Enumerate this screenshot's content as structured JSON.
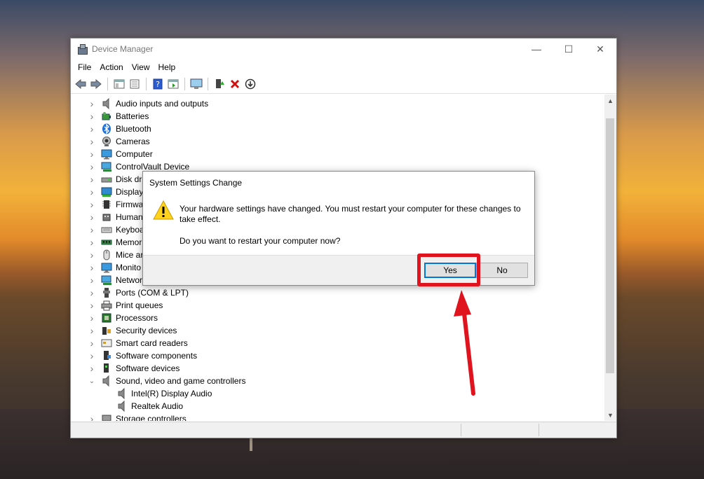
{
  "window": {
    "title": "Device Manager",
    "controls": {
      "minimize": "—",
      "maximize": "☐",
      "close": "✕"
    }
  },
  "menu": [
    "File",
    "Action",
    "View",
    "Help"
  ],
  "toolbar_icons": [
    "back-icon",
    "forward-icon",
    "console-tree-icon",
    "properties-icon",
    "help-icon",
    "action-pane-icon",
    "scan-hardware-icon",
    "update-driver-icon",
    "uninstall-icon",
    "disable-device-icon"
  ],
  "tree": [
    {
      "label": "Audio inputs and outputs",
      "icon": "speaker-icon",
      "expanded": false,
      "level": 0
    },
    {
      "label": "Batteries",
      "icon": "battery-icon",
      "expanded": false,
      "level": 0
    },
    {
      "label": "Bluetooth",
      "icon": "bluetooth-icon",
      "expanded": false,
      "level": 0
    },
    {
      "label": "Cameras",
      "icon": "camera-icon",
      "expanded": false,
      "level": 0
    },
    {
      "label": "Computer",
      "icon": "monitor-icon",
      "expanded": false,
      "level": 0
    },
    {
      "label": "ControlVault Device",
      "icon": "network-monitor-icon",
      "expanded": false,
      "level": 0
    },
    {
      "label": "Disk dri",
      "icon": "disk-icon",
      "expanded": false,
      "level": 0
    },
    {
      "label": "Display",
      "icon": "display-adapter-icon",
      "expanded": false,
      "level": 0
    },
    {
      "label": "Firmwa",
      "icon": "chip-icon",
      "expanded": false,
      "level": 0
    },
    {
      "label": "Human",
      "icon": "hid-icon",
      "expanded": false,
      "level": 0
    },
    {
      "label": "Keyboa",
      "icon": "keyboard-icon",
      "expanded": false,
      "level": 0
    },
    {
      "label": "Memor",
      "icon": "memory-icon",
      "expanded": false,
      "level": 0
    },
    {
      "label": "Mice ar",
      "icon": "mouse-icon",
      "expanded": false,
      "level": 0
    },
    {
      "label": "Monito",
      "icon": "monitor-icon",
      "expanded": false,
      "level": 0
    },
    {
      "label": "Networ",
      "icon": "network-monitor-icon",
      "expanded": false,
      "level": 0
    },
    {
      "label": "Ports (COM & LPT)",
      "icon": "port-icon",
      "expanded": false,
      "level": 0
    },
    {
      "label": "Print queues",
      "icon": "printer-icon",
      "expanded": false,
      "level": 0
    },
    {
      "label": "Processors",
      "icon": "processor-icon",
      "expanded": false,
      "level": 0
    },
    {
      "label": "Security devices",
      "icon": "security-device-icon",
      "expanded": false,
      "level": 0
    },
    {
      "label": "Smart card readers",
      "icon": "smart-card-icon",
      "expanded": false,
      "level": 0
    },
    {
      "label": "Software components",
      "icon": "software-component-icon",
      "expanded": false,
      "level": 0
    },
    {
      "label": "Software devices",
      "icon": "software-device-icon",
      "expanded": false,
      "level": 0
    },
    {
      "label": "Sound, video and game controllers",
      "icon": "speaker-icon",
      "expanded": true,
      "level": 0
    },
    {
      "label": "Intel(R) Display Audio",
      "icon": "speaker-icon",
      "expanded": null,
      "level": 1
    },
    {
      "label": "Realtek Audio",
      "icon": "speaker-icon",
      "expanded": null,
      "level": 1
    },
    {
      "label": "Storage controllers",
      "icon": "storage-controller-icon",
      "expanded": false,
      "level": 0
    }
  ],
  "dialog": {
    "title": "System Settings Change",
    "message": "Your hardware settings have changed. You must restart your computer for these changes to take effect.",
    "question": "Do you want to restart your computer now?",
    "yes_label": "Yes",
    "no_label": "No"
  },
  "colors": {
    "highlight": "#e0141e",
    "default_button_border": "#0078d7"
  }
}
